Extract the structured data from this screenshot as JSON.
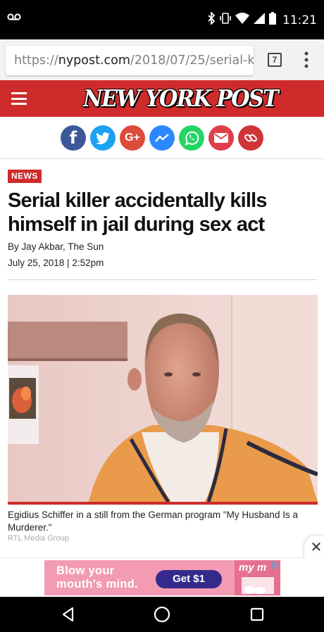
{
  "status_bar": {
    "time": "11:21",
    "icons": [
      "voicemail-icon",
      "bluetooth-icon",
      "vibrate-icon",
      "wifi-icon",
      "signal-icon",
      "battery-icon"
    ]
  },
  "browser": {
    "url_prefix": "https://",
    "url_host": "nypost.com",
    "url_path": "/2018/07/25/serial-killer-",
    "tab_count": "7"
  },
  "site": {
    "logo": "NEW YORK POST",
    "brand_color": "#cf2b2b"
  },
  "share_buttons": [
    {
      "name": "facebook",
      "glyph": "f",
      "color": "#3b5998"
    },
    {
      "name": "twitter",
      "glyph": "",
      "color": "#1da1f2"
    },
    {
      "name": "google-plus",
      "glyph": "G+",
      "color": "#dd4b39"
    },
    {
      "name": "messenger",
      "glyph": "",
      "color": "#2d88ff"
    },
    {
      "name": "whatsapp",
      "glyph": "",
      "color": "#25d366"
    },
    {
      "name": "email",
      "glyph": "",
      "color": "#e03e48"
    },
    {
      "name": "link",
      "glyph": "",
      "color": "#d13438"
    }
  ],
  "article": {
    "tag": "NEWS",
    "headline": "Serial killer accidentally kills himself in jail during sex act",
    "byline": "By Jay Akbar, The Sun",
    "date": "July 25, 2018 | 2:52pm",
    "photo_caption": "Egidius Schiffer in a still from the German program \"My Husband Is a Murderer.\"",
    "photo_credit": "RTL Media Group"
  },
  "ad": {
    "text_line1": "Blow your",
    "text_line2": "mouth's mind.",
    "cta": "Get $1",
    "brand": "my m",
    "close_glyph": "✕"
  }
}
